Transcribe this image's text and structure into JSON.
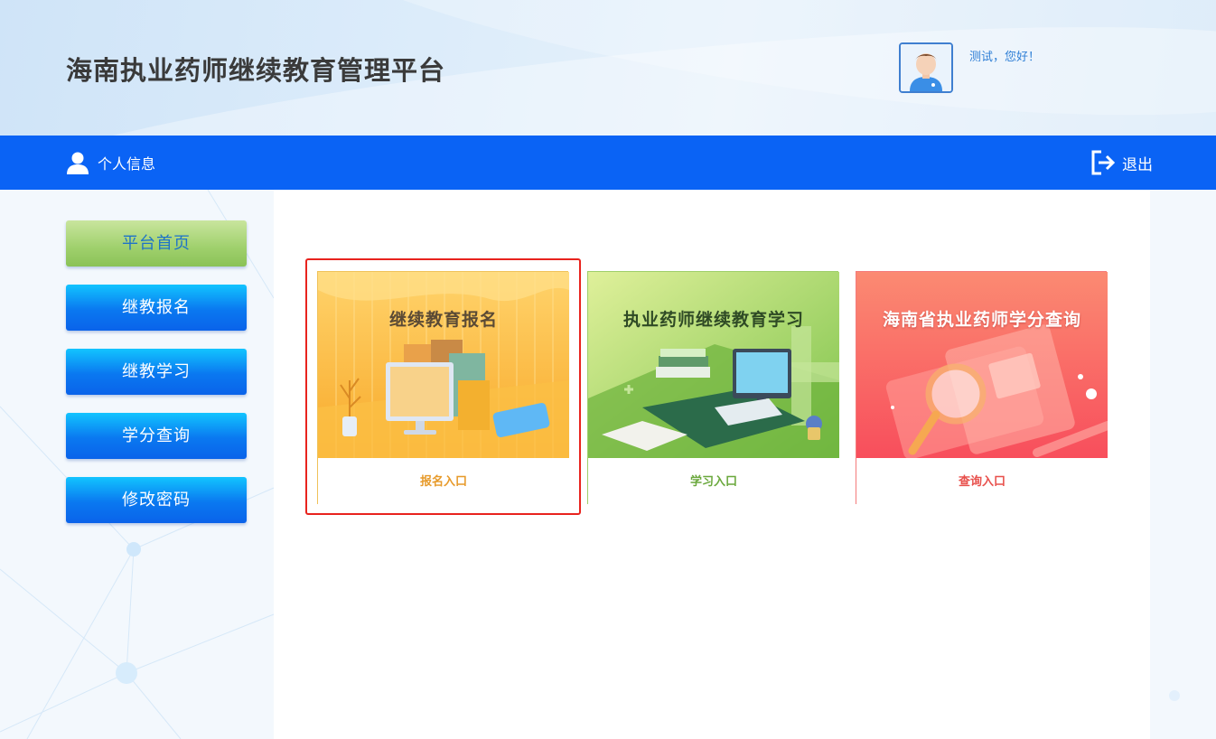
{
  "header": {
    "site_title": "海南执业药师继续教育管理平台",
    "greeting": "测试，您好！",
    "avatar_icon": "user-avatar-icon"
  },
  "navbar": {
    "profile_label": "个人信息",
    "logout_label": "退出",
    "bg_color": "#0a63f5"
  },
  "sidebar": {
    "items": [
      {
        "label": "平台首页",
        "active": true
      },
      {
        "label": "继教报名",
        "active": false
      },
      {
        "label": "继教学习",
        "active": false
      },
      {
        "label": "学分查询",
        "active": false
      },
      {
        "label": "修改密码",
        "active": false
      }
    ]
  },
  "cards": [
    {
      "title": "继续教育报名",
      "entry_label": "报名入口",
      "color": "#f7b23a"
    },
    {
      "title": "执业药师继续教育学习",
      "entry_label": "学习入口",
      "color": "#8cc64e"
    },
    {
      "title": "海南省执业药师学分查询",
      "entry_label": "查询入口",
      "color": "#f8605c"
    }
  ],
  "highlight_color": "#e8231e"
}
